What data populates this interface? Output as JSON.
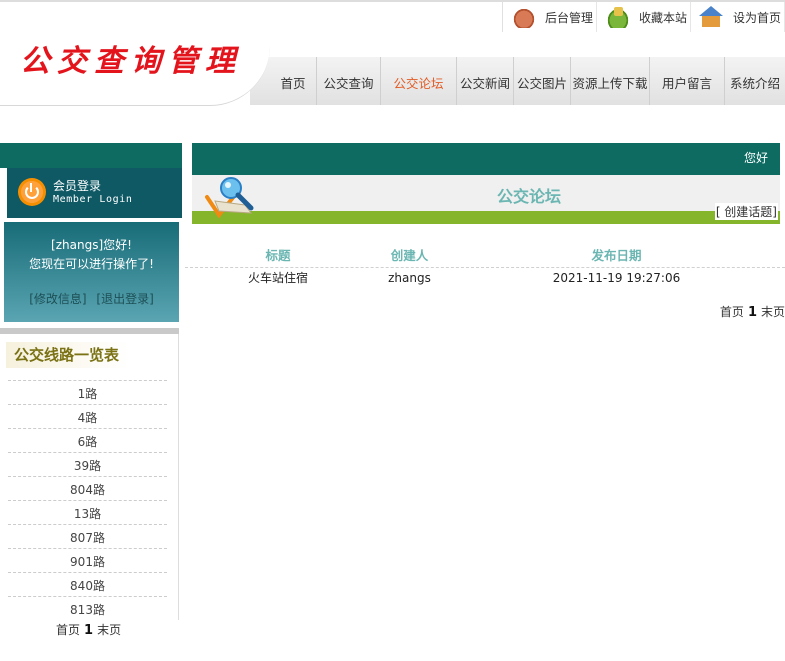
{
  "header": {
    "logo": "公交查询管理",
    "top_links": [
      {
        "label": "后台管理",
        "icon": "phone-icon"
      },
      {
        "label": "收藏本站",
        "icon": "favorite-icon"
      },
      {
        "label": "设为首页",
        "icon": "home-icon"
      }
    ],
    "nav": [
      {
        "label": "首页",
        "active": false
      },
      {
        "label": "公交查询",
        "active": false
      },
      {
        "label": "公交论坛",
        "active": true
      },
      {
        "label": "公交新闻",
        "active": false
      },
      {
        "label": "公交图片",
        "active": false
      },
      {
        "label": "资源上传下载",
        "active": false
      },
      {
        "label": "用户留言",
        "active": false
      },
      {
        "label": "系统介绍",
        "active": false
      }
    ]
  },
  "sidebar": {
    "login": {
      "title": "会员登录",
      "subtitle": "Member Login",
      "greeting": "[zhangs]您好!",
      "message": "您现在可以进行操作了!",
      "edit_link": "[修改信息]",
      "logout_link": "[退出登录]"
    },
    "routes_title": "公交线路一览表",
    "routes": [
      "1路",
      "4路",
      "6路",
      "39路",
      "804路",
      "13路",
      "807路",
      "901路",
      "840路",
      "813路"
    ],
    "pager": {
      "first": "首页",
      "page": "1",
      "last": "末页"
    }
  },
  "main": {
    "top_text": "您好",
    "forum_title": "公交论坛",
    "create_topic": "[ 创建话题]",
    "columns": [
      "标题",
      "创建人",
      "发布日期"
    ],
    "rows": [
      {
        "title": "火车站住宿",
        "author": "zhangs",
        "date": "2021-11-19 19:27:06"
      }
    ],
    "pager": {
      "first": "首页",
      "page": "1",
      "last": "末页"
    }
  },
  "colors": {
    "accent": "#0d6b62",
    "nav_active": "#e25c26",
    "logo": "#e3141c",
    "forum_title": "#6bb6b2",
    "green_bar": "#85b52a"
  }
}
